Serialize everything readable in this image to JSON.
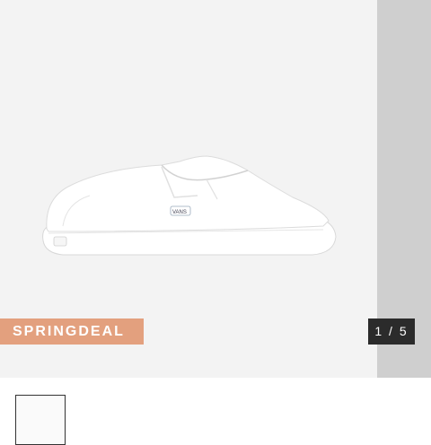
{
  "gallery": {
    "promo_badge": "SPRINGDEAL",
    "counter": "1 / 5",
    "brand_logo_text": "VANS"
  },
  "colors": {
    "badge_bg": "#e3a07e",
    "counter_bg": "#2b2b2b",
    "slide_bg": "#f3f3f3",
    "next_slide_bg": "#cfcfcf"
  }
}
